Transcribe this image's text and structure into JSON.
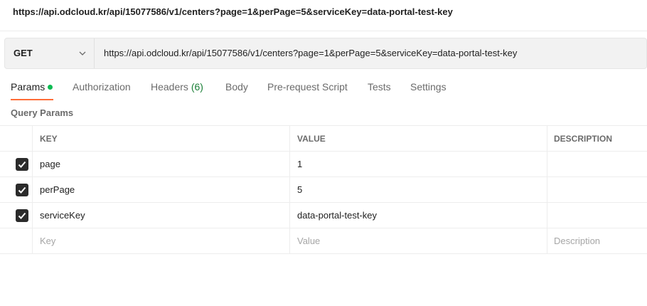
{
  "title": "https://api.odcloud.kr/api/15077586/v1/centers?page=1&perPage=5&serviceKey=data-portal-test-key",
  "request": {
    "method": "GET",
    "method_icon": "chevron-down-icon",
    "url": "https://api.odcloud.kr/api/15077586/v1/centers?page=1&perPage=5&serviceKey=data-portal-test-key"
  },
  "tabs": [
    {
      "label": "Params",
      "active": true,
      "indicator": "green-dot"
    },
    {
      "label": "Authorization"
    },
    {
      "label": "Headers",
      "count": "(6)"
    },
    {
      "label": "Body"
    },
    {
      "label": "Pre-request Script"
    },
    {
      "label": "Tests"
    },
    {
      "label": "Settings"
    }
  ],
  "query_params": {
    "title": "Query Params",
    "columns": {
      "key": "KEY",
      "value": "VALUE",
      "description": "DESCRIPTION"
    },
    "rows": [
      {
        "checked": true,
        "key": "page",
        "value": "1",
        "description": ""
      },
      {
        "checked": true,
        "key": "perPage",
        "value": "5",
        "description": ""
      },
      {
        "checked": true,
        "key": "serviceKey",
        "value": "data-portal-test-key",
        "description": ""
      }
    ],
    "placeholders": {
      "key": "Key",
      "value": "Value",
      "description": "Description"
    }
  },
  "colors": {
    "accent": "#ff6c37",
    "status_dot": "#0cbb52",
    "count_text": "#1a7f37",
    "checkbox": "#2b2b2b"
  }
}
